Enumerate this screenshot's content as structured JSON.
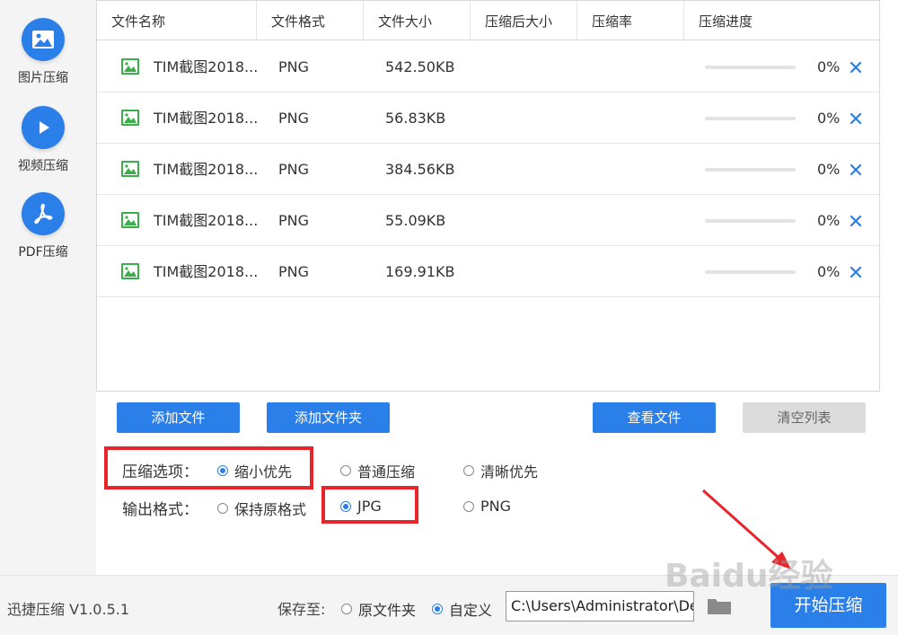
{
  "sidebar": {
    "items": [
      {
        "label": "图片压缩",
        "icon": "image-icon"
      },
      {
        "label": "视频压缩",
        "icon": "play-icon"
      },
      {
        "label": "PDF压缩",
        "icon": "pdf-icon"
      }
    ]
  },
  "table": {
    "headers": [
      "文件名称",
      "文件格式",
      "文件大小",
      "压缩后大小",
      "压缩率",
      "压缩进度"
    ],
    "rows": [
      {
        "name": "TIM截图2018...",
        "format": "PNG",
        "size": "542.50KB",
        "progress": 0,
        "percent": "0%"
      },
      {
        "name": "TIM截图2018...",
        "format": "PNG",
        "size": "56.83KB",
        "progress": 0,
        "percent": "0%"
      },
      {
        "name": "TIM截图2018...",
        "format": "PNG",
        "size": "384.56KB",
        "progress": 0,
        "percent": "0%"
      },
      {
        "name": "TIM截图2018...",
        "format": "PNG",
        "size": "55.09KB",
        "progress": 0,
        "percent": "0%"
      },
      {
        "name": "TIM截图2018...",
        "format": "PNG",
        "size": "169.91KB",
        "progress": 0,
        "percent": "0%"
      }
    ]
  },
  "actions": {
    "add_file": "添加文件",
    "add_folder": "添加文件夹",
    "view_files": "查看文件",
    "clear_list": "清空列表"
  },
  "options": {
    "compress_label": "压缩选项：",
    "compress_choices": [
      "缩小优先",
      "普通压缩",
      "清晰优先"
    ],
    "compress_selected": 0,
    "output_label": "输出格式：",
    "output_choices": [
      "保持原格式",
      "JPG",
      "PNG"
    ],
    "output_selected": 1
  },
  "footer": {
    "version": "迅捷压缩 V1.0.5.1",
    "save_to": "保存至:",
    "save_choices": [
      "原文件夹",
      "自定义"
    ],
    "save_selected": 1,
    "path": "C:\\Users\\Administrator\\Desktop",
    "start": "开始压缩"
  },
  "watermark": "Baidu经验",
  "colors": {
    "accent": "#2a7fe8",
    "highlight": "#e8252b",
    "icon_green": "#3aae4a"
  }
}
